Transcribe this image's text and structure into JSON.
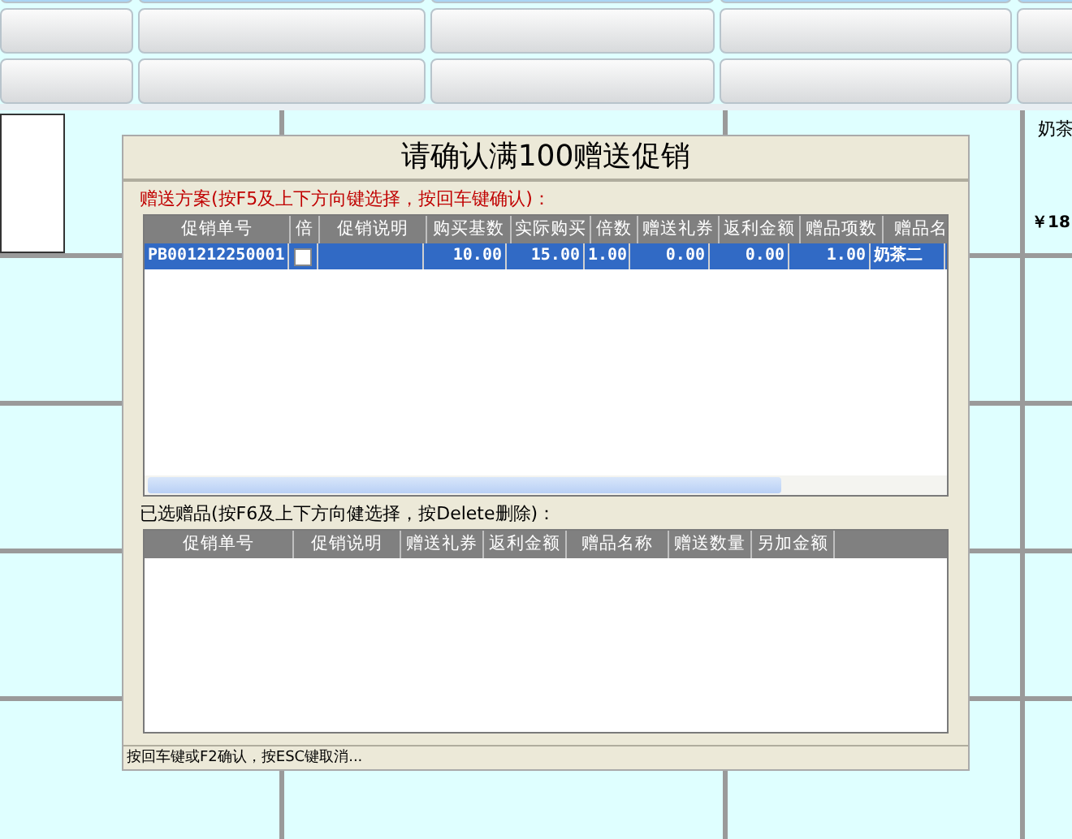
{
  "background": {
    "product_name": "奶茶",
    "product_price": "￥18"
  },
  "dialog": {
    "title": "请确认满100赠送促销",
    "plans_label": "赠送方案(按F5及上下方向键选择，按回车键确认)：",
    "plans_table": {
      "columns": [
        "促销单号",
        "倍",
        "促销说明",
        "购买基数",
        "实际购买",
        "倍数",
        "赠送礼券",
        "返利金额",
        "赠品项数",
        "赠品名"
      ],
      "rows": [
        {
          "selected": true,
          "checked": false,
          "cells": [
            "PB001212250001",
            "",
            "",
            "10.00",
            "15.00",
            "1.00",
            "0.00",
            "0.00",
            "1.00",
            "奶茶二"
          ]
        }
      ]
    },
    "gifts_label": "已选赠品(按F6及上下方向健选择，按Delete删除)：",
    "gifts_table": {
      "columns": [
        "促销单号",
        "促销说明",
        "赠送礼券",
        "返利金额",
        "赠品名称",
        "赠送数量",
        "另加金额"
      ]
    },
    "status": "按回车键或F2确认，按ESC键取消..."
  }
}
